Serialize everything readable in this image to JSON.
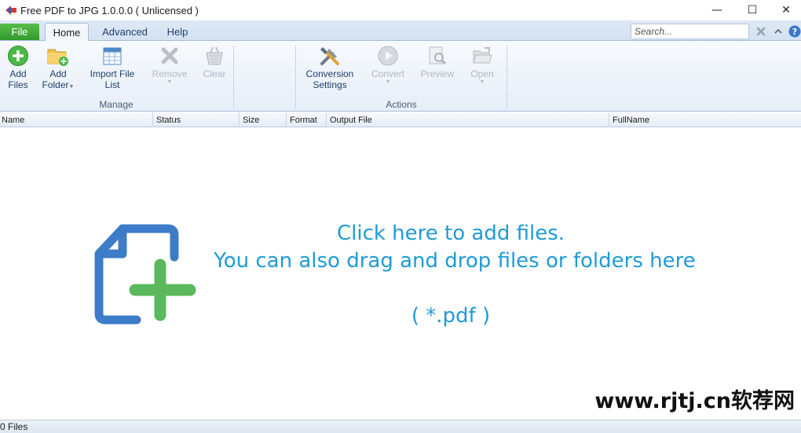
{
  "window": {
    "title": "Free PDF to JPG 1.0.0.0  ( Unlicensed )",
    "minimize_glyph": "—",
    "maximize_glyph": "☐",
    "close_glyph": "✕"
  },
  "tabs": {
    "file": "File",
    "home": "Home",
    "advanced": "Advanced",
    "help": "Help"
  },
  "search": {
    "placeholder": "Search..."
  },
  "ribbon": {
    "add_files": [
      "Add",
      "Files"
    ],
    "add_folder": [
      "Add",
      "Folder"
    ],
    "import_list": [
      "Import File",
      "List"
    ],
    "remove": "Remove",
    "clear": "Clear",
    "conversion_settings": [
      "Conversion",
      "Settings"
    ],
    "convert": "Convert",
    "preview": "Preview",
    "open": "Open",
    "group_manage": "Manage",
    "group_actions": "Actions"
  },
  "columns": {
    "name": "Name",
    "status": "Status",
    "size": "Size",
    "format": "Format",
    "output_file": "Output File",
    "full_name": "FullName"
  },
  "dropzone": {
    "line1": "Click here to add files.",
    "line2": "You can also drag and drop files or folders here",
    "extensions": "( *.pdf )"
  },
  "watermark": "www.rjtj.cn软荐网",
  "status": {
    "file_count": "0 Files"
  },
  "colors": {
    "accent_blue": "#1f9bd7",
    "plus_green": "#5bb85d",
    "doc_blue": "#3d7cc9",
    "file_tab_green": "#3ea435"
  }
}
